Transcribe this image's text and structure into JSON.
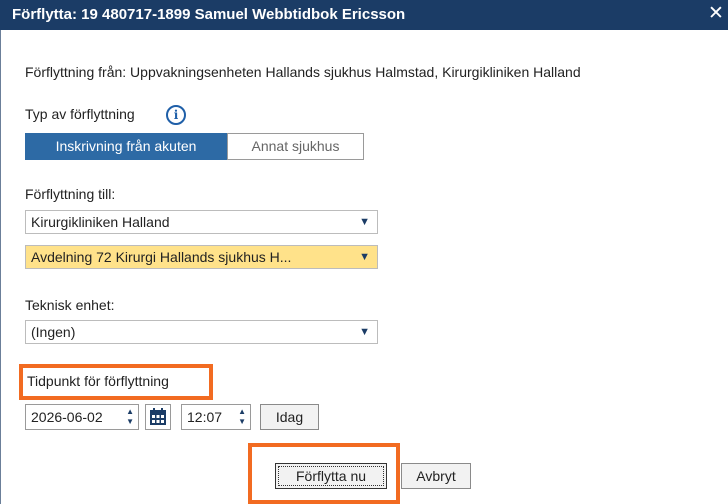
{
  "dialog": {
    "title": "Förflytta: 19 480717-1899 Samuel Webbtidbok Ericsson",
    "close_symbol": "✕",
    "transfer_from": "Förflyttning från: Uppvakningsenheten Hallands sjukhus Halmstad, Kirurgikliniken Halland"
  },
  "type": {
    "label": "Typ av förflyttning",
    "info_icon": "i",
    "options": [
      "Inskrivning från akuten",
      "Annat sjukhus"
    ],
    "selected": "Inskrivning från akuten"
  },
  "transfer_to": {
    "label": "Förflyttning till:",
    "clinic": "Kirurgikliniken Halland",
    "unit": "Avdelning 72 Kirurgi Hallands sjukhus H..."
  },
  "technical_unit": {
    "label": "Teknisk enhet:",
    "value": "(Ingen)"
  },
  "timepoint": {
    "label": "Tidpunkt för förflyttning",
    "date": "2026-06-02",
    "time": "12:07",
    "today_label": "Idag"
  },
  "actions": {
    "move_now": "Förflytta nu",
    "cancel": "Avbryt"
  },
  "colors": {
    "titlebar": "#1b3c66",
    "selected_segment": "#2d6aa5",
    "highlight": "#ffe28a",
    "annotation": "#f26b21"
  },
  "icons": {
    "close": "close-icon",
    "info": "info-icon",
    "dropdown": "chevron-down-icon",
    "calendar": "calendar-icon",
    "spinner": "spinner-icon"
  }
}
